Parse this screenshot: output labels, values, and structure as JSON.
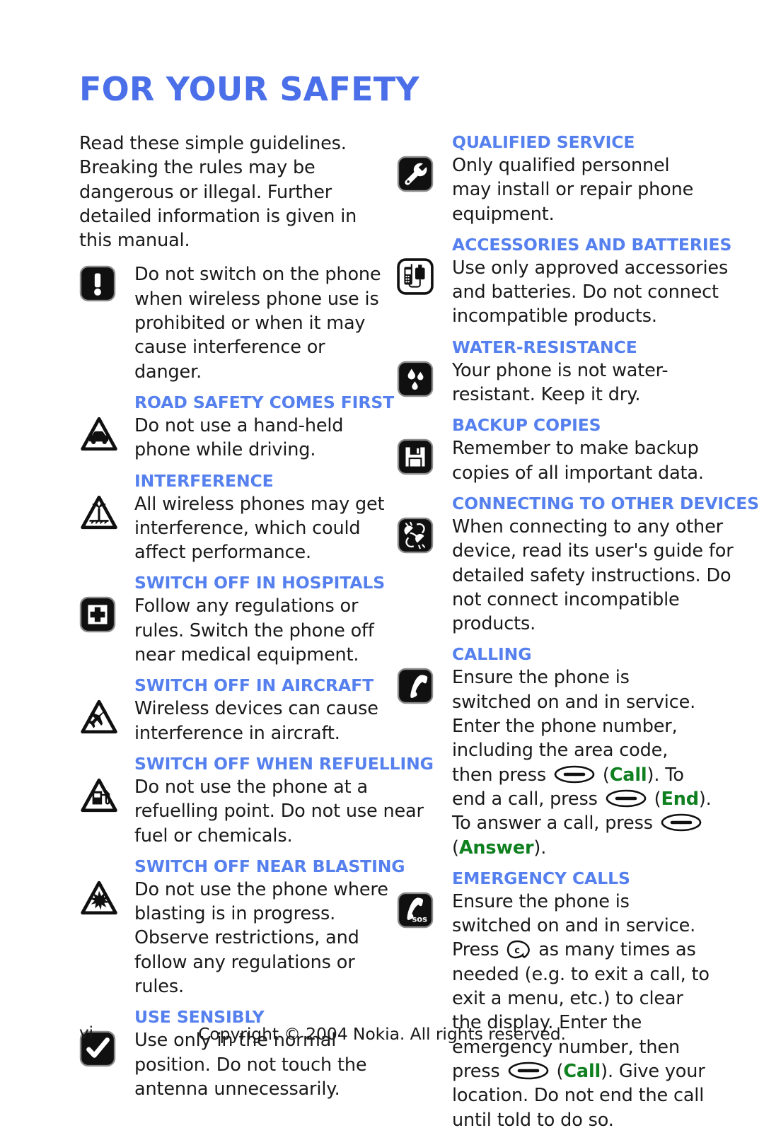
{
  "document": {
    "title": "FOR YOUR SAFETY",
    "intro": "Read these simple guidelines. Breaking the rules may be dangerous or illegal. Further detailed information is given in this manual."
  },
  "left_column": [
    {
      "icon": "exclamation-warning-icon",
      "heading": "",
      "text": "Do not switch on the phone when wireless phone use is prohibited or when it may cause interference or danger."
    },
    {
      "icon": "road-safety-car-triangle-icon",
      "heading": "ROAD SAFETY COMES FIRST",
      "text": "Do not use a hand-held phone while driving."
    },
    {
      "icon": "interference-antenna-triangle-icon",
      "heading": "INTERFERENCE",
      "text": "All wireless phones may get interference, which could affect performance."
    },
    {
      "icon": "hospital-cross-icon",
      "heading": "SWITCH OFF IN HOSPITALS",
      "text": "Follow any regulations or rules. Switch the phone off near medical equipment."
    },
    {
      "icon": "aircraft-triangle-icon",
      "heading": "SWITCH OFF IN AIRCRAFT",
      "text": "Wireless devices can cause interference in aircraft."
    },
    {
      "icon": "fuel-pump-triangle-icon",
      "heading": "SWITCH OFF WHEN REFUELLING",
      "text": "Do not use the phone at a refuelling point. Do not use near fuel or chemicals."
    },
    {
      "icon": "blasting-explosion-triangle-icon",
      "heading": "SWITCH OFF NEAR BLASTING",
      "text": "Do not use the phone where blasting is in progress. Observe restrictions, and follow any regulations or rules."
    },
    {
      "icon": "checkmark-icon",
      "heading": "USE SENSIBLY",
      "text": "Use only in the normal position. Do not touch the antenna unnecessarily."
    }
  ],
  "right_column": [
    {
      "icon": "wrench-service-icon",
      "heading": "QUALIFIED SERVICE",
      "text": "Only qualified personnel may install or repair phone equipment."
    },
    {
      "icon": "accessories-battery-icon",
      "heading": "ACCESSORIES AND BATTERIES",
      "text": "Use only approved accessories and batteries. Do not connect incompatible products."
    },
    {
      "icon": "water-drops-icon",
      "heading": "WATER-RESISTANCE",
      "text": "Your phone is not water-resistant. Keep it dry."
    },
    {
      "icon": "floppy-disk-backup-icon",
      "heading": "BACKUP COPIES",
      "text": "Remember to  make backup copies of all important data."
    },
    {
      "icon": "connector-plugs-icon",
      "heading": "CONNECTING TO OTHER DEVICES",
      "text": "When connecting to any other device, read its user's guide for detailed safety instructions. Do not connect incompatible products."
    },
    {
      "icon": "phone-handset-icon",
      "heading": "CALLING",
      "text_parts": [
        {
          "t": "text",
          "v": "Ensure the phone is switched on and in service. Enter the phone number, including the area code, then press "
        },
        {
          "t": "key",
          "v": "call-key-glyph"
        },
        {
          "t": "text",
          "v": " ("
        },
        {
          "t": "kw",
          "v": "Call"
        },
        {
          "t": "text",
          "v": "). To end a call, press "
        },
        {
          "t": "key",
          "v": "call-key-glyph"
        },
        {
          "t": "text",
          "v": " ("
        },
        {
          "t": "kw",
          "v": "End"
        },
        {
          "t": "text",
          "v": "). To answer a call, press "
        },
        {
          "t": "key",
          "v": "call-key-glyph"
        },
        {
          "t": "text",
          "v": " ("
        },
        {
          "t": "kw",
          "v": "Answer"
        },
        {
          "t": "text",
          "v": ")."
        }
      ]
    },
    {
      "icon": "emergency-sos-icon",
      "heading": "EMERGENCY CALLS",
      "text_parts": [
        {
          "t": "text",
          "v": "Ensure the phone is switched on and in service. Press "
        },
        {
          "t": "ckey",
          "v": "clear-key-glyph"
        },
        {
          "t": "text",
          "v": " as many times as needed (e.g. to exit a call, to exit a menu, etc.) to clear the display. Enter the emergency number, then press "
        },
        {
          "t": "key",
          "v": "call-key-glyph"
        },
        {
          "t": "text",
          "v": " ("
        },
        {
          "t": "kw",
          "v": "Call"
        },
        {
          "t": "text",
          "v": "). Give your location. Do not end the call until told to do so."
        }
      ]
    }
  ],
  "footer": {
    "page_number": "vi",
    "copyright": "Copyright © 2004 Nokia. All rights reserved."
  },
  "colors": {
    "heading_blue": "#5580ee",
    "title_blue": "#4a6fe8",
    "keyword_green": "#0f8020",
    "body_text": "#1a1a1a",
    "background": "#ffffff"
  }
}
